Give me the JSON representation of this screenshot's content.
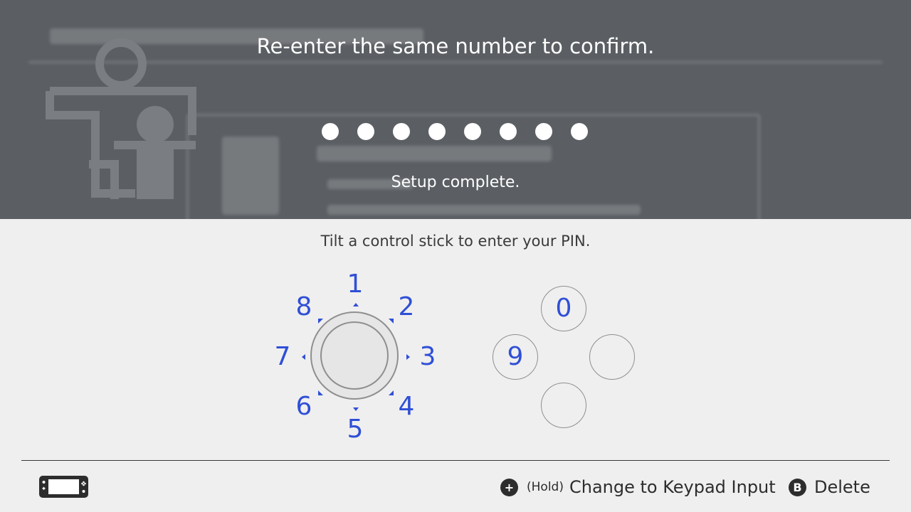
{
  "overlay": {
    "prompt": "Re-enter the same number to confirm.",
    "pin_dot_count": 8,
    "status": "Setup complete."
  },
  "instruction": "Tilt a control stick to enter your PIN.",
  "dial": {
    "n1": "1",
    "n2": "2",
    "n3": "3",
    "n4": "4",
    "n5": "5",
    "n6": "6",
    "n7": "7",
    "n8": "8"
  },
  "pad": {
    "top": "0",
    "left": "9",
    "right": "",
    "bottom": ""
  },
  "footer": {
    "plus_glyph": "+",
    "hold_label": "(Hold)",
    "keypad_label": "Change to Keypad Input",
    "b_glyph": "B",
    "delete_label": "Delete"
  },
  "colors": {
    "accent_blue": "#2f4fd6",
    "overlay_gray": "#5b5f63",
    "panel_bg": "#efefef"
  },
  "icons": [
    "parental-controls-figure-icon",
    "handheld-console-icon",
    "plus-button-icon",
    "b-button-icon"
  ]
}
